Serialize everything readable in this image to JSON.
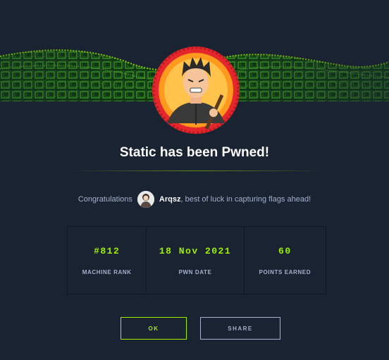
{
  "title": "Static has been Pwned!",
  "congrats": {
    "prefix": "Congratulations",
    "username": "Arqsz",
    "suffix": ", best of luck in capturing flags ahead!"
  },
  "stats": [
    {
      "value": "#812",
      "label": "MACHINE RANK"
    },
    {
      "value": "18 Nov 2021",
      "label": "PWN DATE"
    },
    {
      "value": "60",
      "label": "POINTS EARNED"
    }
  ],
  "buttons": {
    "ok": "OK",
    "share": "SHARE"
  },
  "colors": {
    "background": "#1a2332",
    "accent": "#9fef00",
    "muted": "#a4b1cd",
    "badge_ring": "#e5272d"
  }
}
